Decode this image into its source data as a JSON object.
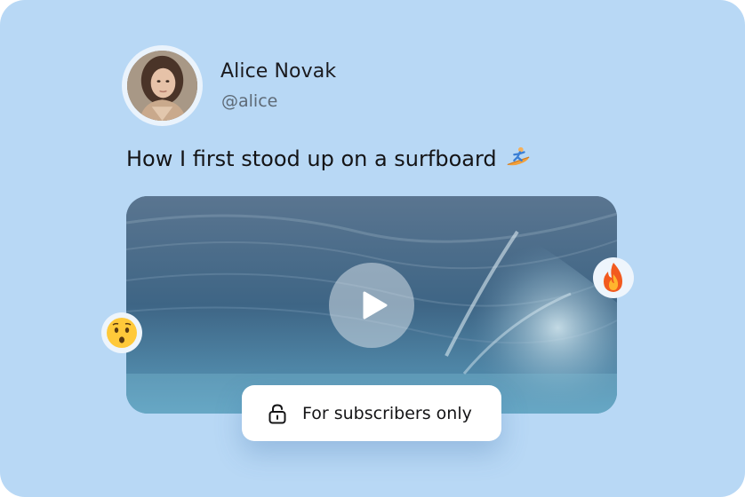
{
  "author": {
    "name": "Alice Novak",
    "handle": "@alice"
  },
  "post": {
    "title": "How I first stood up on a surfboard",
    "title_icon": "surfer-emoji"
  },
  "video": {
    "play_icon": "play-icon"
  },
  "reactions": [
    {
      "icon": "fire-emoji"
    },
    {
      "icon": "astonished-face-emoji"
    }
  ],
  "paywall": {
    "label": "For subscribers only",
    "icon": "lock-icon"
  },
  "colors": {
    "background": "#b8d8f5",
    "pill_background": "#ffffff",
    "text_primary": "#141416",
    "text_secondary": "#5e6a76"
  }
}
